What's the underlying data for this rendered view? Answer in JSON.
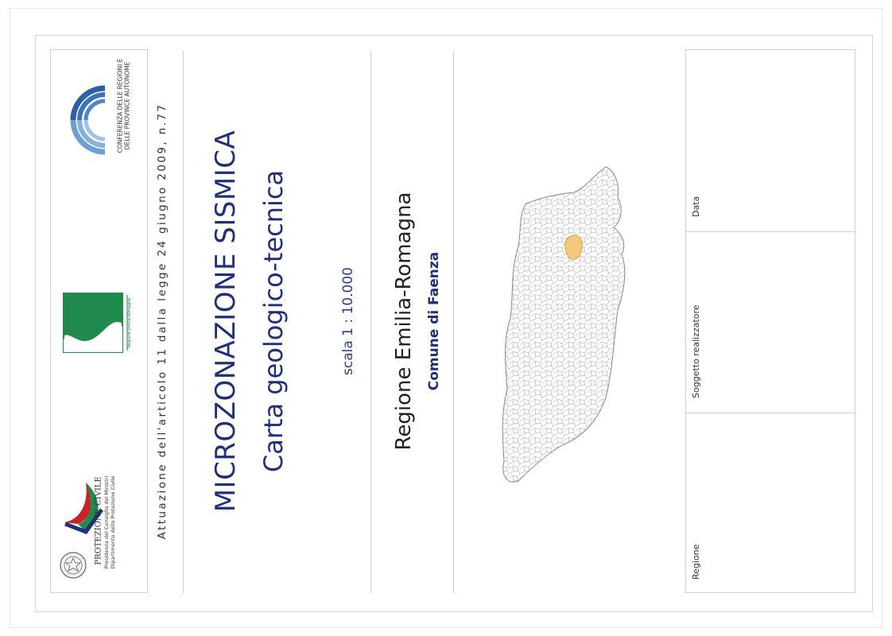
{
  "header": {
    "attuazione": "Attuazione dell'articolo 11 dalla legge 24 giugno 2009, n.77"
  },
  "logos": {
    "protezione_title": "PROTEZIONE CIVILE",
    "protezione_sub1": "Presidenza del Consiglio dei Ministri",
    "protezione_sub2": "Dipartimento della Protezione Civile",
    "regione_caption": "Regione Emilia-Romagna",
    "conferenza_line1": "CONFERENZA DELLE REGIONI E",
    "conferenza_line2": "DELLE PROVINCE AUTONOME",
    "colors": {
      "navy": "#1f2f7a",
      "green": "#1f8a4c",
      "red": "#c82128",
      "blue": "#2b4e8c"
    }
  },
  "title": {
    "main": "MICROZONAZIONE SISMICA",
    "sub": "Carta geologico-tecnica"
  },
  "scale": {
    "label": "scala 1 : 10.000"
  },
  "location": {
    "region": "Regione Emilia-Romagna",
    "comune": "Comune di Faenza",
    "highlight_color": "#f6c87a"
  },
  "table": {
    "regione": "Regione",
    "soggetto": "Soggetto realizzatore",
    "data": "Data"
  }
}
